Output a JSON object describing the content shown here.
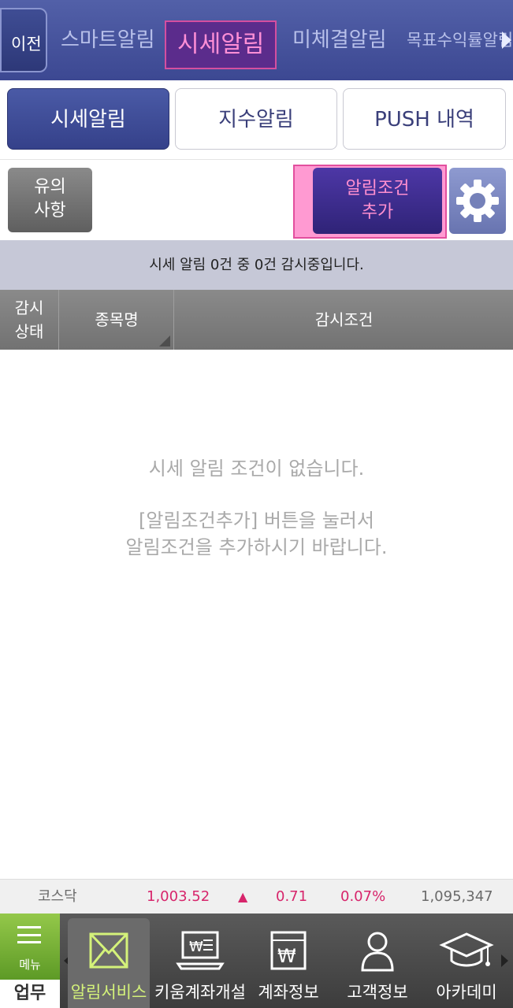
{
  "header": {
    "back_label": "이전",
    "tabs": [
      {
        "label": "스마트알림"
      },
      {
        "label": "시세알림"
      },
      {
        "label": "미체결알림"
      },
      {
        "label": "목표수익률알림"
      }
    ]
  },
  "subtabs": [
    {
      "label": "시세알림"
    },
    {
      "label": "지수알림"
    },
    {
      "label": "PUSH 내역"
    }
  ],
  "toolbar": {
    "notice_line1": "유의",
    "notice_line2": "사항",
    "add_line1": "알림조건",
    "add_line2": "추가"
  },
  "status_text": "시세 알림 0건 중 0건 감시중입니다.",
  "table": {
    "col_status_line1": "감시",
    "col_status_line2": "상태",
    "col_name": "종목명",
    "col_condition": "감시조건"
  },
  "empty": {
    "line1": "시세 알림 조건이 없습니다.",
    "line2": "[알림조건추가] 버튼을 눌러서",
    "line3": "알림조건을 추가하시기 바랍니다."
  },
  "ticker": {
    "name": "코스닥",
    "value": "1,003.52",
    "direction_symbol": "▲",
    "change": "0.71",
    "percent": "0.07%",
    "volume": "1,095,347",
    "up_color": "#d7256b"
  },
  "bottom_nav": {
    "menu_label": "메뉴",
    "work_label": "업무",
    "items": [
      {
        "label": "알림서비스",
        "icon": "envelope-icon"
      },
      {
        "label": "키움계좌개설",
        "icon": "laptop-won-icon"
      },
      {
        "label": "계좌정보",
        "icon": "document-won-icon"
      },
      {
        "label": "고객정보",
        "icon": "person-icon"
      },
      {
        "label": "아카데미",
        "icon": "graduation-cap-icon"
      }
    ]
  }
}
